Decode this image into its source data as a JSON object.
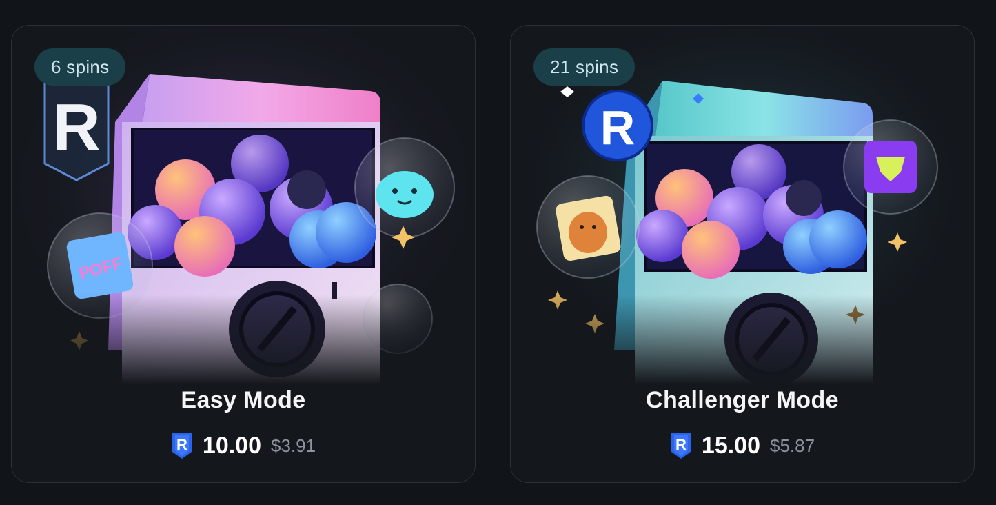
{
  "modes": [
    {
      "id": "easy",
      "spins": "6 spins",
      "title": "Easy Mode",
      "price": "10.00",
      "usd": "$3.91",
      "coin_icon": "ron-coin-icon",
      "machine_accent": "#e38be6"
    },
    {
      "id": "challenger",
      "spins": "21 spins",
      "title": "Challenger Mode",
      "price": "15.00",
      "usd": "$5.87",
      "coin_icon": "ron-coin-icon",
      "machine_accent": "#6fd3de"
    }
  ],
  "colors": {
    "background": "#111419",
    "card": "#14171c",
    "badge": "#1b3f48",
    "coin": "#2b64e8"
  }
}
